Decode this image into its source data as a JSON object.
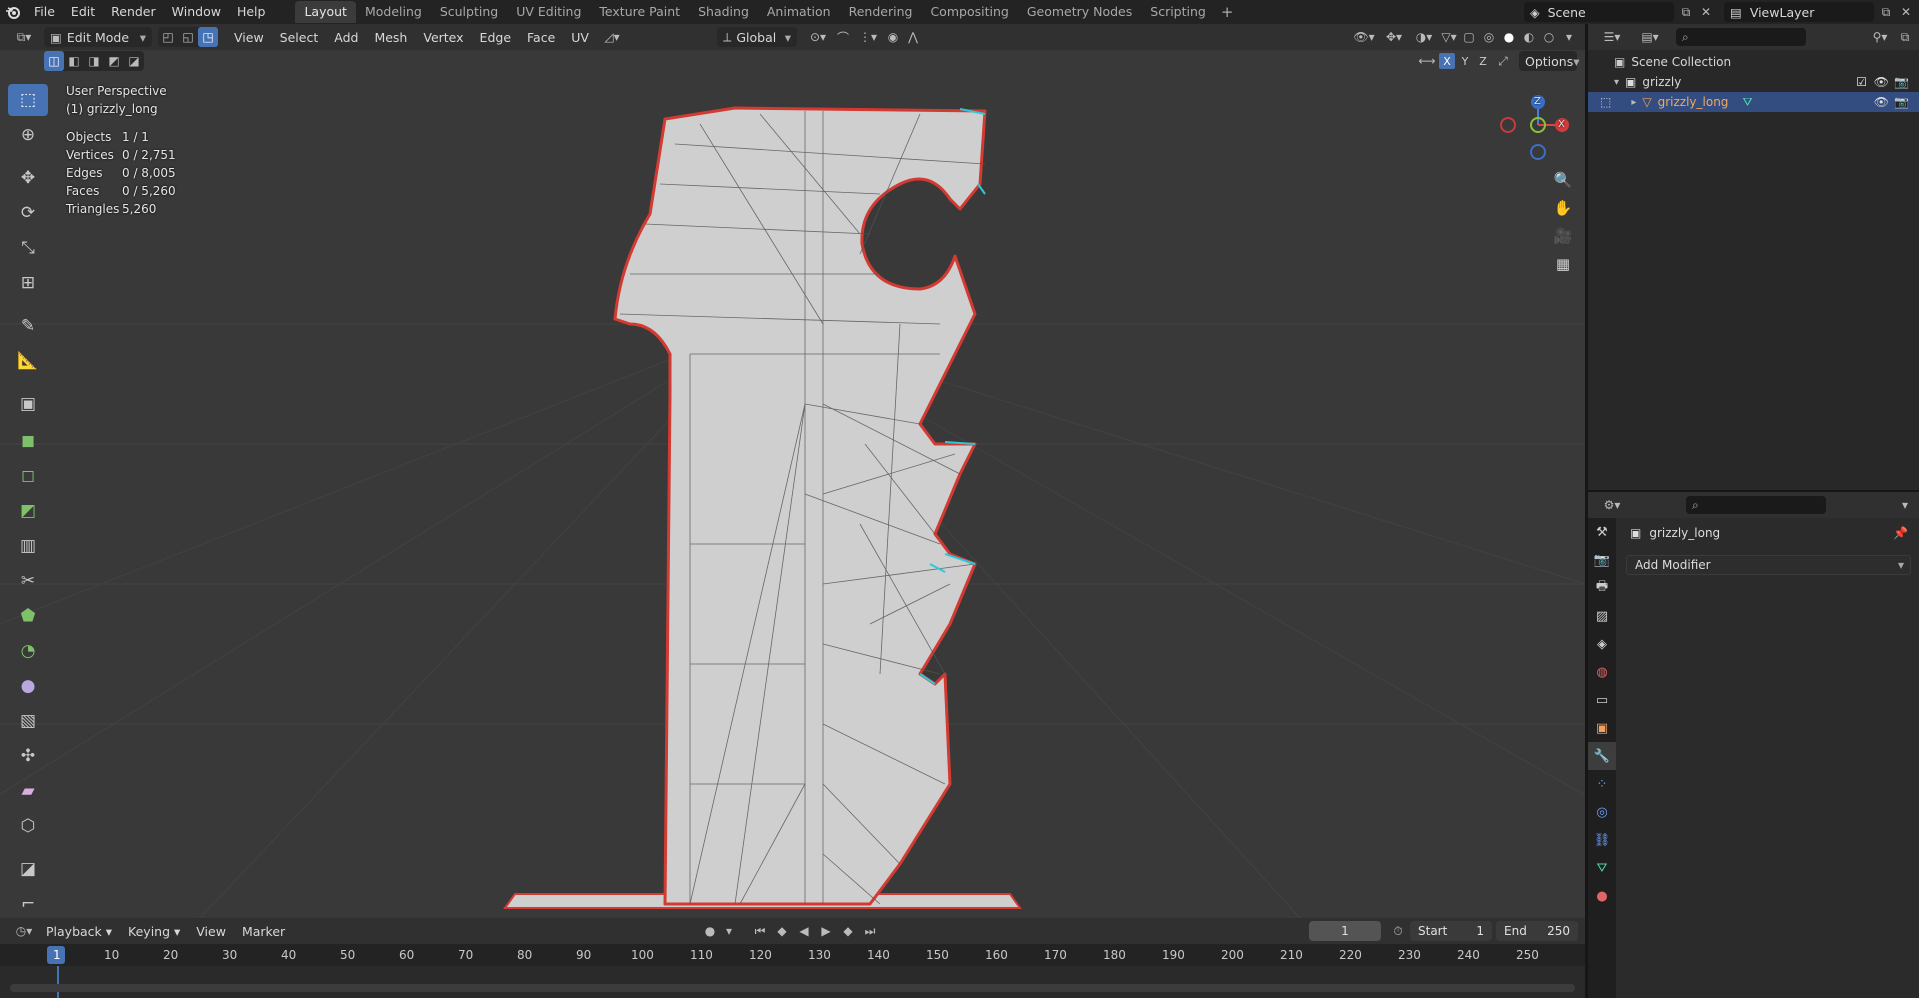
{
  "topbar": {
    "logo_icon": "blender-logo-icon",
    "menus": [
      "File",
      "Edit",
      "Render",
      "Window",
      "Help"
    ],
    "workspaces": [
      "Layout",
      "Modeling",
      "Sculpting",
      "UV Editing",
      "Texture Paint",
      "Shading",
      "Animation",
      "Rendering",
      "Compositing",
      "Geometry Nodes",
      "Scripting"
    ],
    "active_workspace": "Layout",
    "add_workspace": "+",
    "scene_label": "Scene",
    "viewlayer_label": "ViewLayer"
  },
  "viewport": {
    "mode": "Edit Mode",
    "menus": [
      "View",
      "Select",
      "Add",
      "Mesh",
      "Vertex",
      "Edge",
      "Face",
      "UV"
    ],
    "transform_orientation": "Global",
    "options_label": "Options",
    "axis_x": "X",
    "axis_y": "Y",
    "axis_z": "Z",
    "perspective": "User Perspective",
    "object_label": "(1) grizzly_long",
    "stats": [
      {
        "label": "Objects",
        "value": "1 / 1"
      },
      {
        "label": "Vertices",
        "value": "0 / 2,751"
      },
      {
        "label": "Edges",
        "value": "0 / 8,005"
      },
      {
        "label": "Faces",
        "value": "0 / 5,260"
      },
      {
        "label": "Triangles",
        "value": "5,260"
      }
    ],
    "gizmo": {
      "x": "X",
      "y": "Y",
      "z": "Z"
    },
    "colors": {
      "background": "#393939",
      "mesh": "#cfcfcf",
      "boundary": "#d23a32",
      "seam": "#2fc8d8"
    }
  },
  "timeline": {
    "menus": [
      "Playback",
      "Keying",
      "View",
      "Marker"
    ],
    "current_frame": "1",
    "start_label": "Start",
    "start_value": "1",
    "end_label": "End",
    "end_value": "250",
    "ruler": [
      "1",
      "10",
      "20",
      "30",
      "40",
      "50",
      "60",
      "70",
      "80",
      "90",
      "100",
      "110",
      "120",
      "130",
      "140",
      "150",
      "160",
      "170",
      "180",
      "190",
      "200",
      "210",
      "220",
      "230",
      "240",
      "250"
    ]
  },
  "outliner": {
    "root": "Scene Collection",
    "collection": "grizzly",
    "object": "grizzly_long"
  },
  "properties": {
    "object_name": "grizzly_long",
    "add_modifier": "Add Modifier"
  }
}
